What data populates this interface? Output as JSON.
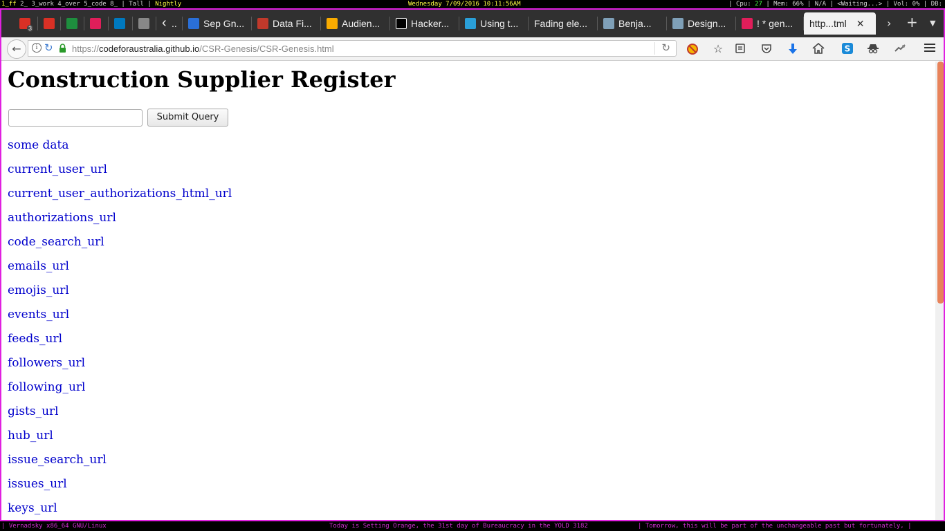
{
  "system_bar": {
    "workspaces": {
      "current": "1_ff",
      "others": " 2_ 3_work 4_over 5_code 8_",
      "layout": "Tall",
      "app": "Nightly"
    },
    "clock": "Wednesday  7/09/2016 10:11:56AM",
    "stats": {
      "cpu_label": "| Cpu: ",
      "cpu_value": "27",
      "rest": " | Mem: 66% | N/A | <Waiting...> | Vol: 0% | DB:"
    }
  },
  "tabs": [
    {
      "label": "",
      "icon": "gmail-icon",
      "badge": "3"
    },
    {
      "label": "",
      "icon": "gmail-icon"
    },
    {
      "label": "",
      "icon": "drive-icon"
    },
    {
      "label": "",
      "icon": "slack-icon"
    },
    {
      "label": "",
      "icon": "trello-icon"
    },
    {
      "label": "",
      "icon": "spiral-icon"
    },
    {
      "label": "..",
      "icon": "chevron-left-icon"
    },
    {
      "label": "Sep Gn...",
      "icon": "doc-icon"
    },
    {
      "label": "Data Fi...",
      "icon": "pen-icon"
    },
    {
      "label": "Audien...",
      "icon": "analytics-icon"
    },
    {
      "label": "Hacker...",
      "icon": "medium-icon"
    },
    {
      "label": "Using t...",
      "icon": "gear-icon"
    },
    {
      "label": "Fading ele...",
      "icon": ""
    },
    {
      "label": "Benja...",
      "icon": "stack-icon"
    },
    {
      "label": "Design...",
      "icon": "stack-icon"
    },
    {
      "label": "! * gen...",
      "icon": "slack-icon"
    },
    {
      "label": "http...tml",
      "icon": "",
      "active": true
    }
  ],
  "address_bar": {
    "scheme": "https://",
    "domain": "codeforaustralia.github.io",
    "path": "/CSR-Genesis/CSR-Genesis.html"
  },
  "page": {
    "title": "Construction Supplier Register",
    "search": {
      "value": "",
      "placeholder": ""
    },
    "submit_label": "Submit Query",
    "links": [
      "some data",
      "current_user_url",
      "current_user_authorizations_html_url",
      "authorizations_url",
      "code_search_url",
      "emails_url",
      "emojis_url",
      "events_url",
      "feeds_url",
      "followers_url",
      "following_url",
      "gists_url",
      "hub_url",
      "issue_search_url",
      "issues_url",
      "keys_url"
    ]
  },
  "bottom_bar": {
    "left": "| Vernadsky x86_64 GNU/Linux",
    "middle": "Today is Setting Orange, the 31st day of Bureaucracy in the YOLD 3182",
    "right": "| Tomorrow, this will be part of the unchangeable past but fortunately, |"
  },
  "colors": {
    "frame": "#e020e0",
    "link": "#0000cc",
    "scroll_thumb": "#e8835a",
    "tabbar_bg": "#303030"
  }
}
